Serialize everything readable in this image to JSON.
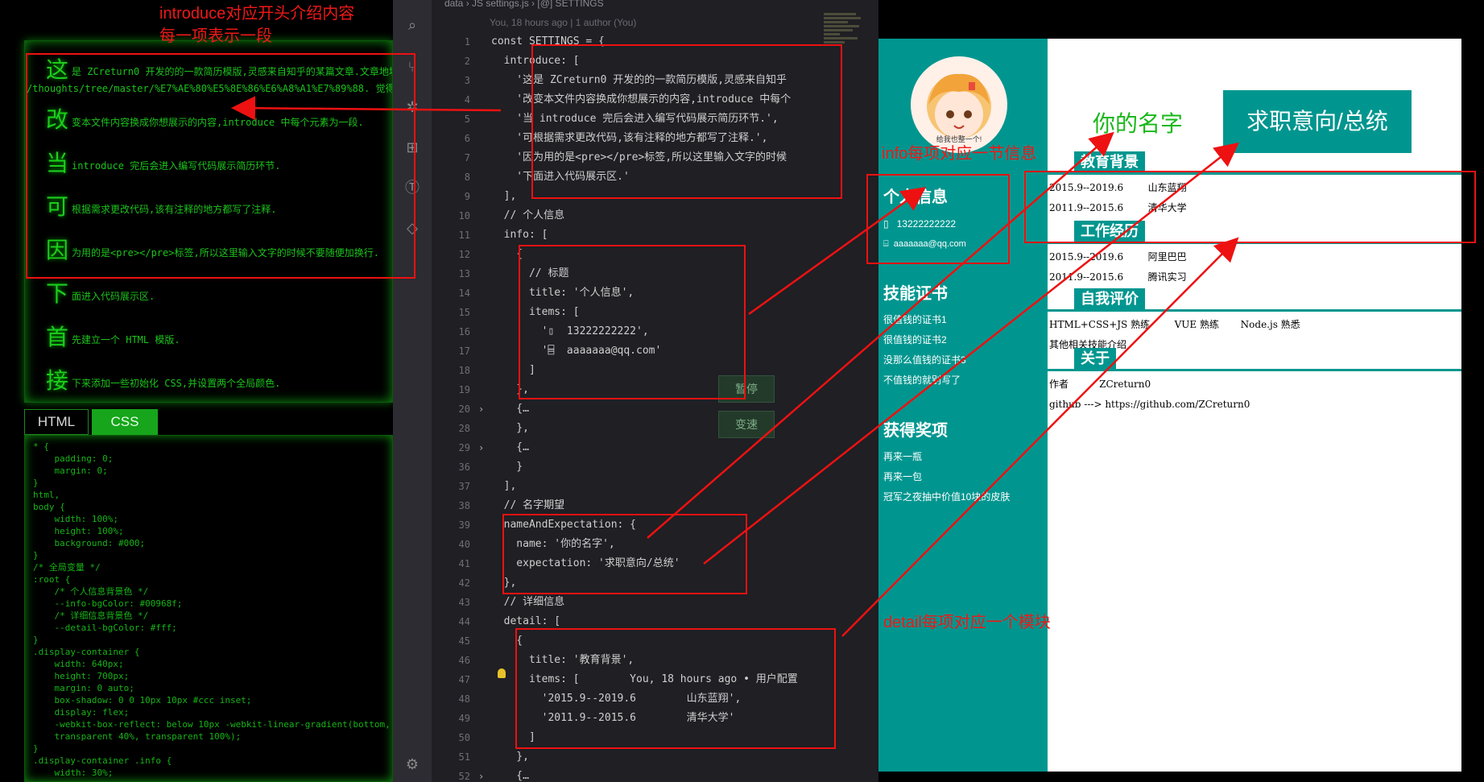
{
  "intro_panel": {
    "paragraphs": [
      {
        "first": "这",
        "rest": "是 ZCreturn0 开发的的一款简历模版,灵感来自知乎的某篇文章.文章地址: https://",
        "wrap": "/thoughts/tree/master/%E7%AE%80%E5%8E%86%E6%A8%A1%E7%89%88. 觉得不错麻烦给个 ★star !!"
      },
      {
        "first": "改",
        "rest": "变本文件内容换成你想展示的内容,introduce 中每个元素为一段."
      },
      {
        "first": "当",
        "rest": " introduce 完后会进入编写代码展示简历环节."
      },
      {
        "first": "可",
        "rest": "根据需求更改代码,该有注释的地方都写了注释."
      },
      {
        "first": "因",
        "rest": "为用的是<pre></pre>标签,所以这里输入文字的时候不要随便加换行."
      },
      {
        "first": "下",
        "rest": "面进入代码展示区."
      },
      {
        "first": "首",
        "rest": "先建立一个 HTML 模版."
      },
      {
        "first": "接",
        "rest": "下来添加一些初始化 CSS,并设置两个全局颜色."
      }
    ]
  },
  "tabs": {
    "html": "HTML",
    "css": "CSS"
  },
  "css_code": "* {\n    padding: 0;\n    margin: 0;\n}\nhtml,\nbody {\n    width: 100%;\n    height: 100%;\n    background: #000;\n}\n/* 全局变量 */\n:root {\n    /* 个人信息背景色 */\n    --info-bgColor: #00968f;\n    /* 详细信息背景色 */\n    --detail-bgColor: #fff;\n}\n.display-container {\n    width: 640px;\n    height: 700px;\n    margin: 0 auto;\n    box-shadow: 0 0 10px 10px #ccc inset;\n    display: flex;\n    -webkit-box-reflect: below 10px -webkit-linear-gradient(bottom, rgba(255, 255, 255, 0.3) 0%,\n    transparent 40%, transparent 100%);\n}\n.display-container .info {\n    width: 30%;",
  "editor": {
    "breadcrumb": "data  ›  JS settings.js  ›  [@] SETTINGS",
    "blame": "You, 18 hours ago | 1 author (You)",
    "blame_inline": "You, 18 hours ago • 用户配置",
    "ghost_pause": "暂停",
    "ghost_speed": "变速"
  },
  "code_lines": [
    {
      "n": "1",
      "fold": "",
      "t": "const SETTINGS = {"
    },
    {
      "n": "2",
      "fold": "",
      "t": "  introduce: ["
    },
    {
      "n": "3",
      "fold": "",
      "t": "    '这是 ZCreturn0 开发的的一款简历模版,灵感来自知乎"
    },
    {
      "n": "4",
      "fold": "",
      "t": "    '改变本文件内容换成你想展示的内容,introduce 中每个"
    },
    {
      "n": "5",
      "fold": "",
      "t": "    '当 introduce 完后会进入编写代码展示简历环节.',"
    },
    {
      "n": "6",
      "fold": "",
      "t": "    '可根据需求更改代码,该有注释的地方都写了注释.',"
    },
    {
      "n": "7",
      "fold": "",
      "t": "    '因为用的是<pre></pre>标签,所以这里输入文字的时候"
    },
    {
      "n": "8",
      "fold": "",
      "t": "    '下面进入代码展示区.'"
    },
    {
      "n": "9",
      "fold": "",
      "t": "  ],"
    },
    {
      "n": "10",
      "fold": "",
      "t": "  // 个人信息"
    },
    {
      "n": "11",
      "fold": "",
      "t": "  info: ["
    },
    {
      "n": "12",
      "fold": "",
      "t": "    {"
    },
    {
      "n": "13",
      "fold": "",
      "t": "      // 标题"
    },
    {
      "n": "14",
      "fold": "",
      "t": "      title: '个人信息',"
    },
    {
      "n": "15",
      "fold": "",
      "t": "      items: ["
    },
    {
      "n": "16",
      "fold": "",
      "t": "        '▯  13222222222',"
    },
    {
      "n": "17",
      "fold": "",
      "t": "        '⌸  aaaaaaa@qq.com'"
    },
    {
      "n": "18",
      "fold": "",
      "t": "      ]"
    },
    {
      "n": "19",
      "fold": "",
      "t": "    },"
    },
    {
      "n": "20",
      "fold": "›",
      "t": "    {…"
    },
    {
      "n": "28",
      "fold": "",
      "t": "    },"
    },
    {
      "n": "29",
      "fold": "›",
      "t": "    {…"
    },
    {
      "n": "36",
      "fold": "",
      "t": "    }"
    },
    {
      "n": "37",
      "fold": "",
      "t": "  ],"
    },
    {
      "n": "38",
      "fold": "",
      "t": "  // 名字期望"
    },
    {
      "n": "39",
      "fold": "",
      "t": "  nameAndExpectation: {"
    },
    {
      "n": "40",
      "fold": "",
      "t": "    name: '你的名字',"
    },
    {
      "n": "41",
      "fold": "",
      "t": "    expectation: '求职意向/总统'"
    },
    {
      "n": "42",
      "fold": "",
      "t": "  },"
    },
    {
      "n": "43",
      "fold": "",
      "t": "  // 详细信息"
    },
    {
      "n": "44",
      "fold": "",
      "t": "  detail: ["
    },
    {
      "n": "45",
      "fold": "",
      "t": "    {"
    },
    {
      "n": "46",
      "fold": "",
      "t": "      title: '教育背景',"
    },
    {
      "n": "47",
      "fold": "",
      "t": "      items: [        You, 18 hours ago • 用户配置"
    },
    {
      "n": "48",
      "fold": "",
      "t": "        '2015.9--2019.6        山东蓝翔',"
    },
    {
      "n": "49",
      "fold": "",
      "t": "        '2011.9--2015.6        清华大学'"
    },
    {
      "n": "50",
      "fold": "",
      "t": "      ]"
    },
    {
      "n": "51",
      "fold": "",
      "t": "    },"
    },
    {
      "n": "52",
      "fold": "›",
      "t": "    {…"
    }
  ],
  "resume": {
    "avatar_caption": "给我也整一个!",
    "info_title": "个人信息",
    "phone": "13222222222",
    "email": "aaaaaaa@qq.com",
    "cert_title": "技能证书",
    "certs": [
      "很值钱的证书1",
      "很值钱的证书2",
      "没那么值钱的证书3",
      "不值钱的就别写了"
    ],
    "award_title": "获得奖项",
    "awards": [
      "再来一瓶",
      "再来一包",
      "冠军之夜抽中价值10块的皮肤"
    ],
    "name": "你的名字",
    "expectation": "求职意向/总统",
    "modules": [
      {
        "title": "教育背景",
        "items": [
          "2015.9--2019.6        山东蓝翔",
          "2011.9--2015.6        清华大学"
        ]
      },
      {
        "title": "工作经历",
        "items": [
          "2015.9--2019.6        阿里巴巴",
          "2011.9--2015.6        腾讯实习"
        ]
      },
      {
        "title": "自我评价",
        "items": [
          "HTML+CSS+JS 熟练        VUE 熟练       Node.js 熟悉",
          "其他相关技能介绍"
        ]
      },
      {
        "title": "关于",
        "items": [
          "作者          ZCreturn0",
          "github ---> https://github.com/ZCreturn0"
        ]
      }
    ]
  },
  "annotations": {
    "intro_note_1": "introduce对应开头介绍内容",
    "intro_note_2": "每一项表示一段",
    "info_note": "info每项对应一节信息",
    "detail_note": "detail每项对应一个模块"
  },
  "colors": {
    "terminal_green": "#16c016",
    "resume_teal": "#00968f",
    "annotation_red": "#e11111",
    "name_green": "#1ab81a"
  }
}
